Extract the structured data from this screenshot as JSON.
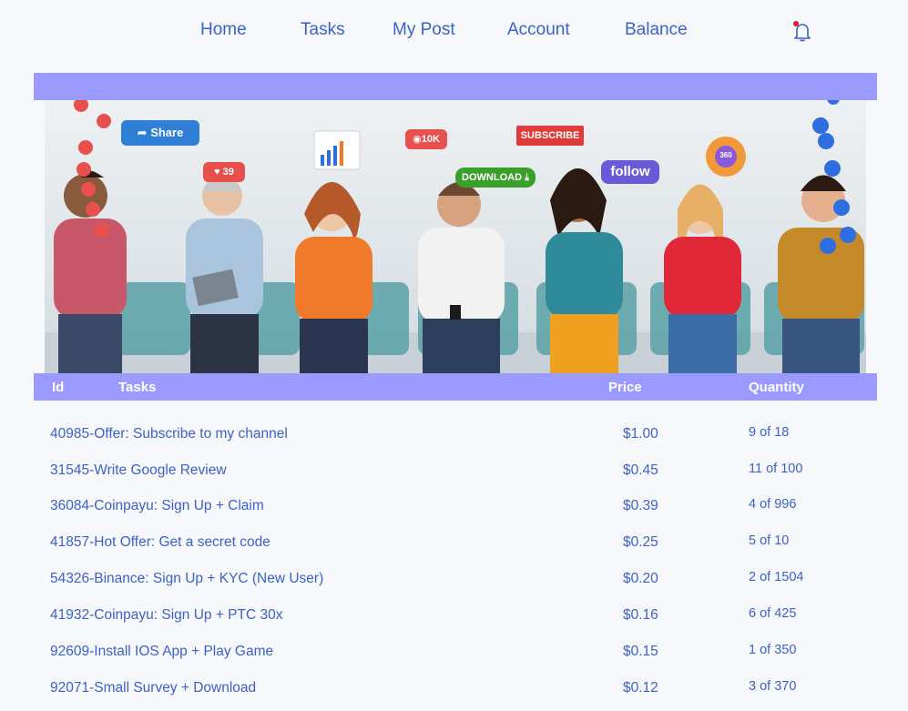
{
  "nav": {
    "items": [
      "Home",
      "Tasks",
      "My Post",
      "Account",
      "Balance"
    ]
  },
  "banner": {
    "share": "Share",
    "likes": "39",
    "views": "10K",
    "subscribe": "SUBSCRIBE",
    "download": "DOWNLOAD",
    "follow": "follow",
    "badge": "360"
  },
  "table": {
    "headers": {
      "id": "Id",
      "tasks": "Tasks",
      "price": "Price",
      "quantity": "Quantity"
    },
    "rows": [
      {
        "task": "40985-Offer: Subscribe to my channel",
        "price": "$1.00",
        "quantity": "9 of 18"
      },
      {
        "task": "31545-Write Google Review",
        "price": "$0.45",
        "quantity": "11 of 100"
      },
      {
        "task": "36084-Coinpayu: Sign Up + Claim",
        "price": "$0.39",
        "quantity": "4 of 996"
      },
      {
        "task": "41857-Hot Offer: Get a secret code",
        "price": "$0.25",
        "quantity": "5 of 10"
      },
      {
        "task": "54326-Binance: Sign Up + KYC (New User)",
        "price": "$0.20",
        "quantity": "2 of 1504"
      },
      {
        "task": "41932-Coinpayu: Sign Up + PTC 30x",
        "price": "$0.16",
        "quantity": "6 of 425"
      },
      {
        "task": "92609-Install IOS App + Play Game",
        "price": "$0.15",
        "quantity": "1 of 350"
      },
      {
        "task": "92071-Small Survey + Download",
        "price": "$0.12",
        "quantity": "3 of 370"
      }
    ]
  }
}
